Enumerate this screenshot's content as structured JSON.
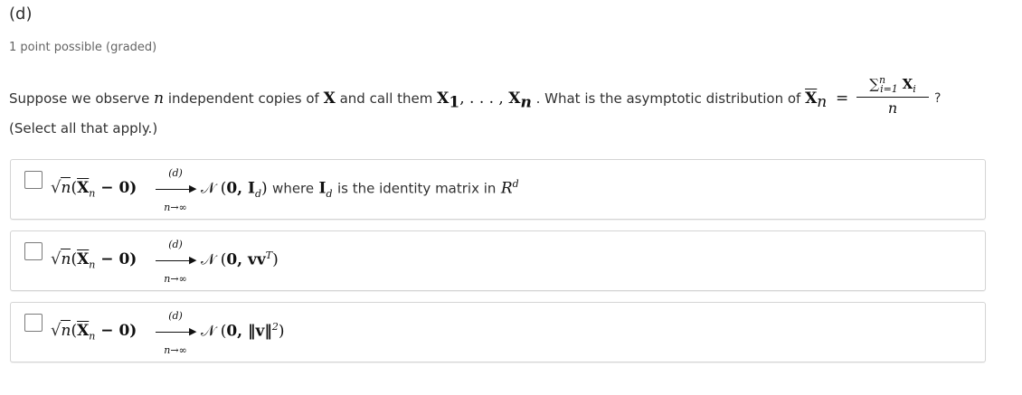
{
  "title": "(d)",
  "points": "1 point possible (graded)",
  "question": {
    "p1": "Suppose we observe",
    "n": "n",
    "p2": "independent copies of",
    "X": "X",
    "p3": "and call them",
    "copies": "X",
    "copies_sub1": "1",
    "copies_mid": ", . . . , ",
    "copies_last": "X",
    "copies_subn": "n",
    "p4": ". What is the asymptotic distribution of",
    "xbar": "X",
    "xbar_sub": "n",
    "eq": "=",
    "frac_sum": "∑",
    "frac_sum_sup": "n",
    "frac_sum_sub": "i=1",
    "frac_X": "X",
    "frac_X_sub": "i",
    "frac_den": "n",
    "qmark": "?"
  },
  "select_note": "(Select all that apply.)",
  "arrow": {
    "top": "(d)",
    "bottom": "n→∞"
  },
  "lhs": {
    "sqrt": "√",
    "n": "n",
    "open": "(",
    "xbar": "X",
    "sub": "n",
    "minus_zero": " − 0)"
  },
  "options": [
    {
      "dist": "𝒩 (",
      "args": "0, I",
      "args_sub": "d",
      "close": ")",
      "where": "where",
      "I": "I",
      "I_sub": "d",
      "rest": "is the identity matrix in",
      "R": "R",
      "R_sup": "d"
    },
    {
      "dist": "𝒩 (",
      "args": "0, vv",
      "args_sup": "T",
      "close": ")"
    },
    {
      "dist": "𝒩 (",
      "args": "0, ‖v‖",
      "args_sup": "2",
      "close": ")"
    }
  ]
}
